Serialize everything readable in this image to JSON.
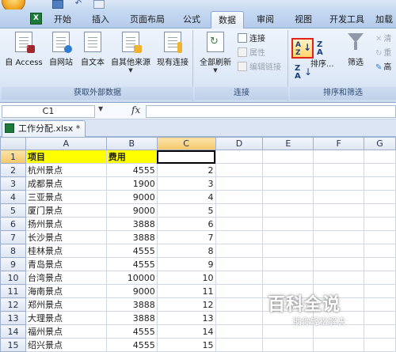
{
  "ribbon_tabs": [
    "开始",
    "插入",
    "页面布局",
    "公式",
    "数据",
    "审阅",
    "视图",
    "开发工具",
    "加载"
  ],
  "external_group": {
    "label": "获取外部数据",
    "buttons": [
      "自 Access",
      "自网站",
      "自文本",
      "自其他来源",
      "现有连接"
    ]
  },
  "connections_group": {
    "label": "连接",
    "refresh": "全部刷新",
    "connections": "连接",
    "properties": "属性",
    "edit_links": "编辑链接"
  },
  "sort_group": {
    "label": "排序和筛选",
    "sort": "排序...",
    "filter": "筛选",
    "clear": "清",
    "reapply": "重",
    "advanced": "高"
  },
  "formula_bar": {
    "name_box": "C1",
    "fx": "fx",
    "value": ""
  },
  "workbook": {
    "tab": "工作分配.xlsx *"
  },
  "columns": [
    "A",
    "B",
    "C",
    "D",
    "E",
    "F",
    "G"
  ],
  "rows": [
    {
      "n": "1",
      "a": "项目",
      "b": "费用",
      "c": ""
    },
    {
      "n": "2",
      "a": "杭州景点",
      "b": "4555",
      "c": "2"
    },
    {
      "n": "3",
      "a": "成都景点",
      "b": "1900",
      "c": "3"
    },
    {
      "n": "4",
      "a": "三亚景点",
      "b": "9000",
      "c": "4"
    },
    {
      "n": "5",
      "a": "厦门景点",
      "b": "9000",
      "c": "5"
    },
    {
      "n": "6",
      "a": "扬州景点",
      "b": "3888",
      "c": "6"
    },
    {
      "n": "7",
      "a": "长沙景点",
      "b": "3888",
      "c": "7"
    },
    {
      "n": "8",
      "a": "桂林景点",
      "b": "4555",
      "c": "8"
    },
    {
      "n": "9",
      "a": "青岛景点",
      "b": "4555",
      "c": "9"
    },
    {
      "n": "10",
      "a": "台湾景点",
      "b": "10000",
      "c": "10"
    },
    {
      "n": "11",
      "a": "海南景点",
      "b": "9000",
      "c": "11"
    },
    {
      "n": "12",
      "a": "郑州景点",
      "b": "3888",
      "c": "12"
    },
    {
      "n": "13",
      "a": "大理景点",
      "b": "3888",
      "c": "13"
    },
    {
      "n": "14",
      "a": "福州景点",
      "b": "4555",
      "c": "14"
    },
    {
      "n": "15",
      "a": "绍兴景点",
      "b": "4555",
      "c": "15"
    }
  ],
  "watermark": {
    "title": "百科全说",
    "subtitle": "助你轻松解决"
  }
}
